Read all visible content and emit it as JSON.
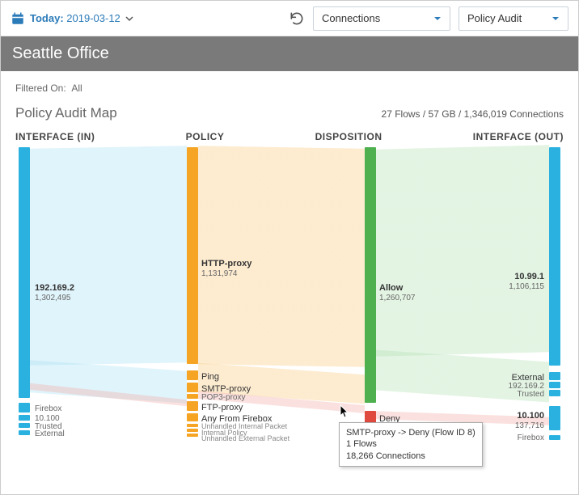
{
  "topbar": {
    "date_label": "Today:",
    "date_value": "2019-03-12",
    "dropdown_connections": "Connections",
    "dropdown_audit": "Policy Audit"
  },
  "title": "Seattle Office",
  "filtered_label": "Filtered On:",
  "filtered_value": "All",
  "map_title": "Policy Audit Map",
  "stats": "27 Flows / 57 GB / 1,346,019 Connections",
  "columns": {
    "c1": "INTERFACE (IN)",
    "c2": "POLICY",
    "c3": "DISPOSITION",
    "c4": "INTERFACE (OUT)"
  },
  "nodes": {
    "in_main": {
      "name": "192.169.2",
      "val": "1,302,495"
    },
    "in_firebox": {
      "name": "Firebox"
    },
    "in_10100": {
      "name": "10.100"
    },
    "in_trusted": {
      "name": "Trusted"
    },
    "in_external": {
      "name": "External"
    },
    "pol_http": {
      "name": "HTTP-proxy",
      "val": "1,131,974"
    },
    "pol_ping": {
      "name": "Ping"
    },
    "pol_smtp": {
      "name": "SMTP-proxy"
    },
    "pol_pop3": {
      "name": "POP3-proxy"
    },
    "pol_ftp": {
      "name": "FTP-proxy"
    },
    "pol_any": {
      "name": "Any From Firebox"
    },
    "pol_uip": {
      "name": "Unhandled Internal Packet"
    },
    "pol_ip": {
      "name": "Internal Policy"
    },
    "pol_uep": {
      "name": "Unhandled External Packet"
    },
    "disp_allow": {
      "name": "Allow",
      "val": "1,260,707"
    },
    "disp_deny": {
      "name": "Deny"
    },
    "out_main": {
      "name": "10.99.1",
      "val": "1,106,115"
    },
    "out_external": {
      "name": "External"
    },
    "out_192": {
      "name": "192.169.2"
    },
    "out_trusted": {
      "name": "Trusted"
    },
    "out_10100": {
      "name": "10.100",
      "val": "137,716"
    },
    "out_firebox": {
      "name": "Firebox"
    }
  },
  "tooltip": {
    "line1": "SMTP-proxy -> Deny (Flow ID 8)",
    "line2": "1 Flows",
    "line3": "18,266 Connections"
  }
}
